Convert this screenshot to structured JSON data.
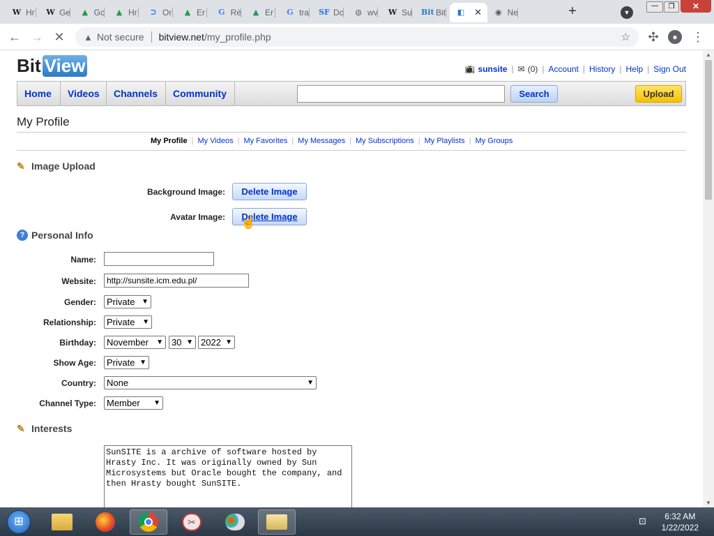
{
  "browser": {
    "tabs": [
      {
        "icon": "wikipedia-icon",
        "glyph": "W",
        "label": "Hr"
      },
      {
        "icon": "wikipedia-icon",
        "glyph": "W",
        "label": "Ge"
      },
      {
        "icon": "google-drive-icon",
        "glyph": "▲",
        "label": "Gc"
      },
      {
        "icon": "google-drive-icon",
        "glyph": "▲",
        "label": "Hr"
      },
      {
        "icon": "link-icon",
        "glyph": "⊃",
        "label": "Or"
      },
      {
        "icon": "google-drive-icon",
        "glyph": "▲",
        "label": "Er"
      },
      {
        "icon": "google-icon",
        "glyph": "G",
        "label": "Rè"
      },
      {
        "icon": "google-drive-icon",
        "glyph": "▲",
        "label": "Er"
      },
      {
        "icon": "google-icon",
        "glyph": "G",
        "label": "tra"
      },
      {
        "icon": "sourceforge-icon",
        "glyph": "SF",
        "label": "Dc"
      },
      {
        "icon": "globe-icon",
        "glyph": "◍",
        "label": "wv"
      },
      {
        "icon": "wikipedia-icon",
        "glyph": "W",
        "label": "Su"
      },
      {
        "icon": "bitview-icon",
        "glyph": "Bit",
        "label": "Bit"
      },
      {
        "icon": "bitview-icon",
        "glyph": "◧",
        "label": ""
      },
      {
        "icon": "chrome-icon",
        "glyph": "◉",
        "label": "Ne"
      }
    ],
    "url_warning": "Not secure",
    "url_host": "bitview.net",
    "url_path": "/my_profile.php"
  },
  "site": {
    "logo_bit": "Bit",
    "logo_view": "View",
    "username": "sunsite",
    "messages_count": "(0)",
    "user_links": [
      "Account",
      "History",
      "Help",
      "Sign Out"
    ],
    "nav": [
      "Home",
      "Videos",
      "Channels",
      "Community"
    ],
    "search_label": "Search",
    "upload_label": "Upload"
  },
  "page": {
    "title": "My Profile",
    "subnav": [
      "My Profile",
      "My Videos",
      "My Favorites",
      "My Messages",
      "My Subscriptions",
      "My Playlists",
      "My Groups"
    ],
    "image_upload": {
      "heading": "Image Upload",
      "background_label": "Background Image:",
      "avatar_label": "Avatar Image:",
      "delete_label": "Delete Image"
    },
    "personal_info": {
      "heading": "Personal Info",
      "name_label": "Name:",
      "name_value": "",
      "website_label": "Website:",
      "website_value": "http://sunsite.icm.edu.pl/",
      "gender_label": "Gender:",
      "gender_value": "Private",
      "relationship_label": "Relationship:",
      "relationship_value": "Private",
      "birthday_label": "Birthday:",
      "birthday_month": "November",
      "birthday_day": "30",
      "birthday_year": "2022",
      "show_age_label": "Show Age:",
      "show_age_value": "Private",
      "country_label": "Country:",
      "country_value": "None",
      "channel_type_label": "Channel Type:",
      "channel_type_value": "Member"
    },
    "interests": {
      "heading": "Interests",
      "text": "SunSITE is a archive of software hosted by\nHrasty Inc. It was originally owned by Sun\nMicrosystems but Oracle bought the company, and\nthen Hrasty bought SunSITE."
    }
  },
  "taskbar": {
    "time": "6:32 AM",
    "date": "1/22/2022"
  }
}
